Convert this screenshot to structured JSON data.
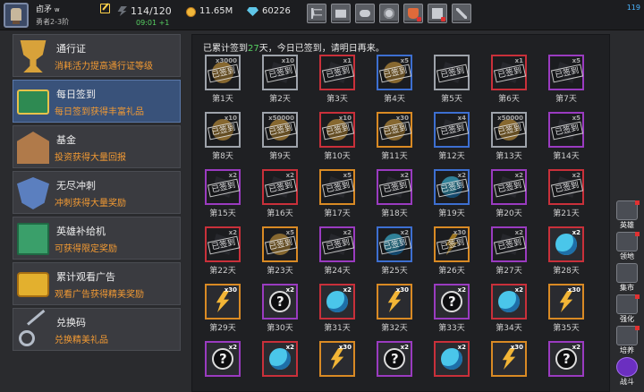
{
  "topbar": {
    "player_name": "卣矛",
    "player_sub": "w",
    "rank": "勇者2-3阶",
    "energy": "114/120",
    "energy_timer": "09:01 +1",
    "coins": "11.65M",
    "gems": "60226",
    "fps": "119",
    "buttons": [
      "cart-icon",
      "mail-icon",
      "gamepad-icon",
      "gear-icon",
      "bag-icon",
      "book-icon",
      "swords-icon"
    ]
  },
  "menu": [
    {
      "title": "通行证",
      "desc": "消耗活力提高通行证等级",
      "icon": "trophy-icon"
    },
    {
      "title": "每日签到",
      "desc": "每日签到获得丰富礼品",
      "icon": "chest-icon",
      "active": true
    },
    {
      "title": "基金",
      "desc": "投资获得大量回报",
      "icon": "bank-icon"
    },
    {
      "title": "无尽冲刺",
      "desc": "冲刺获得大量奖励",
      "icon": "shield-icon"
    },
    {
      "title": "英雄补给机",
      "desc": "可获得限定奖励",
      "icon": "supply-machine-icon"
    },
    {
      "title": "累计观看广告",
      "desc": "观看广告获得精美奖励",
      "icon": "gold-chest-icon"
    },
    {
      "title": "兑换码",
      "desc": "兑换精美礼品",
      "icon": "key-icon"
    }
  ],
  "signin": {
    "text_prefix": "已累计签到",
    "days_signed": "27",
    "text_suffix": "天，今日已签到，请明日再来。",
    "stamp_label": "已签到",
    "days": [
      {
        "label": "第1天",
        "qty": "x3000",
        "item": "coin",
        "border": "white",
        "signed": true
      },
      {
        "label": "第2天",
        "qty": "x10",
        "item": "ticket",
        "border": "white",
        "signed": true
      },
      {
        "label": "第3天",
        "qty": "x1",
        "item": "ticket",
        "border": "red",
        "signed": true
      },
      {
        "label": "第4天",
        "qty": "x5",
        "item": "coin",
        "border": "blue",
        "signed": true
      },
      {
        "label": "第5天",
        "qty": "",
        "item": "ticket",
        "border": "white",
        "signed": true
      },
      {
        "label": "第6天",
        "qty": "x1",
        "item": "ticket",
        "border": "red",
        "signed": true
      },
      {
        "label": "第7天",
        "qty": "x5",
        "item": "ticket",
        "border": "purple",
        "signed": true
      },
      {
        "label": "第8天",
        "qty": "x10",
        "item": "coin",
        "border": "white",
        "signed": true
      },
      {
        "label": "第9天",
        "qty": "x50000",
        "item": "coin",
        "border": "white",
        "signed": true
      },
      {
        "label": "第10天",
        "qty": "x10",
        "item": "coin",
        "border": "red",
        "signed": true
      },
      {
        "label": "第11天",
        "qty": "x30",
        "item": "coin",
        "border": "orange",
        "signed": true
      },
      {
        "label": "第12天",
        "qty": "x4",
        "item": "ticket",
        "border": "blue",
        "signed": true
      },
      {
        "label": "第13天",
        "qty": "x50000",
        "item": "coin",
        "border": "white",
        "signed": true
      },
      {
        "label": "第14天",
        "qty": "x5",
        "item": "ticket",
        "border": "purple",
        "signed": true
      },
      {
        "label": "第15天",
        "qty": "x2",
        "item": "ticket",
        "border": "purple",
        "signed": true
      },
      {
        "label": "第16天",
        "qty": "x2",
        "item": "ticket",
        "border": "red",
        "signed": true
      },
      {
        "label": "第17天",
        "qty": "x5",
        "item": "ticket",
        "border": "orange",
        "signed": true
      },
      {
        "label": "第18天",
        "qty": "x2",
        "item": "ticket",
        "border": "purple",
        "signed": true
      },
      {
        "label": "第19天",
        "qty": "x2",
        "item": "orb",
        "border": "blue",
        "signed": true
      },
      {
        "label": "第20天",
        "qty": "x2",
        "item": "ticket",
        "border": "purple",
        "signed": true
      },
      {
        "label": "第21天",
        "qty": "x2",
        "item": "ticket",
        "border": "red",
        "signed": true
      },
      {
        "label": "第22天",
        "qty": "x2",
        "item": "ticket",
        "border": "red",
        "signed": true
      },
      {
        "label": "第23天",
        "qty": "x5",
        "item": "coin",
        "border": "orange",
        "signed": true
      },
      {
        "label": "第24天",
        "qty": "x2",
        "item": "ticket",
        "border": "purple",
        "signed": true
      },
      {
        "label": "第25天",
        "qty": "x2",
        "item": "orb",
        "border": "blue",
        "signed": true
      },
      {
        "label": "第26天",
        "qty": "x30",
        "item": "bolt",
        "border": "orange",
        "signed": true
      },
      {
        "label": "第27天",
        "qty": "x2",
        "item": "ticket",
        "border": "purple",
        "signed": true
      },
      {
        "label": "第28天",
        "qty": "x2",
        "item": "orb",
        "border": "red",
        "signed": false
      },
      {
        "label": "第29天",
        "qty": "x30",
        "item": "bolt",
        "border": "orange",
        "signed": false
      },
      {
        "label": "第30天",
        "qty": "x2",
        "item": "mystery",
        "border": "purple",
        "signed": false
      },
      {
        "label": "第31天",
        "qty": "x2",
        "item": "orb",
        "border": "red",
        "signed": false
      },
      {
        "label": "第32天",
        "qty": "x30",
        "item": "bolt",
        "border": "orange",
        "signed": false
      },
      {
        "label": "第33天",
        "qty": "x2",
        "item": "mystery",
        "border": "purple",
        "signed": false
      },
      {
        "label": "第34天",
        "qty": "x2",
        "item": "orb",
        "border": "red",
        "signed": false
      },
      {
        "label": "第35天",
        "qty": "x30",
        "item": "bolt",
        "border": "orange",
        "signed": false
      },
      {
        "label": "",
        "qty": "x2",
        "item": "mystery",
        "border": "purple",
        "signed": false
      },
      {
        "label": "",
        "qty": "x2",
        "item": "orb",
        "border": "red",
        "signed": false
      },
      {
        "label": "",
        "qty": "x30",
        "item": "bolt",
        "border": "orange",
        "signed": false
      },
      {
        "label": "",
        "qty": "x2",
        "item": "mystery",
        "border": "purple",
        "signed": false
      },
      {
        "label": "",
        "qty": "x2",
        "item": "orb",
        "border": "red",
        "signed": false
      },
      {
        "label": "",
        "qty": "x30",
        "item": "bolt",
        "border": "orange",
        "signed": false
      },
      {
        "label": "",
        "qty": "x2",
        "item": "mystery",
        "border": "purple",
        "signed": false
      }
    ]
  },
  "rightbar": [
    {
      "label": "英雄",
      "icon": "hero-icon",
      "badge": true
    },
    {
      "label": "领地",
      "icon": "territory-icon",
      "badge": true
    },
    {
      "label": "集市",
      "icon": "market-icon",
      "badge": false
    },
    {
      "label": "强化",
      "icon": "enhance-icon",
      "badge": true
    },
    {
      "label": "培养",
      "icon": "train-icon",
      "badge": true
    },
    {
      "label": "战斗",
      "icon": "battle-icon",
      "badge": false
    }
  ]
}
